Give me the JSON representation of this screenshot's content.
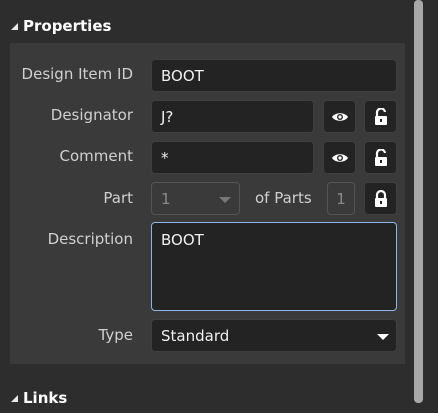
{
  "properties": {
    "header": "Properties",
    "design_item_id": {
      "label": "Design Item ID",
      "value": "BOOT"
    },
    "designator": {
      "label": "Designator",
      "value": "J?"
    },
    "comment": {
      "label": "Comment",
      "value": "*"
    },
    "part": {
      "label": "Part",
      "value": "1",
      "of_parts_label": "of Parts",
      "of_parts_value": "1"
    },
    "description": {
      "label": "Description",
      "value": "BOOT"
    },
    "type": {
      "label": "Type",
      "value": "Standard"
    }
  },
  "links": {
    "header": "Links"
  },
  "icons": {
    "visibility": "eye-icon",
    "unlock": "unlock-icon",
    "lock": "lock-icon",
    "collapse": "collapse-triangle-icon",
    "dropdown": "chevron-down-icon"
  },
  "colors": {
    "panel_bg": "#2d2d2d",
    "group_bg": "#3a3a3a",
    "field_bg": "#232323",
    "focus_border": "#8db6e6",
    "scrollbar_thumb": "#a8a8a8"
  }
}
